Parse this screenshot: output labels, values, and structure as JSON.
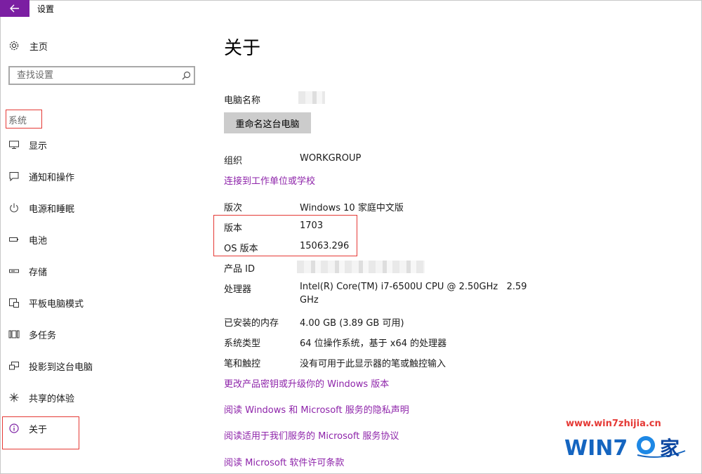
{
  "window": {
    "title": "设置"
  },
  "sidebar": {
    "home_label": "主页",
    "search_placeholder": "查找设置",
    "section_label": "系统",
    "items": [
      {
        "label": "显示",
        "icon": "monitor-icon"
      },
      {
        "label": "通知和操作",
        "icon": "notification-icon"
      },
      {
        "label": "电源和睡眠",
        "icon": "power-icon"
      },
      {
        "label": "电池",
        "icon": "battery-icon"
      },
      {
        "label": "存储",
        "icon": "storage-icon"
      },
      {
        "label": "平板电脑模式",
        "icon": "tablet-mode-icon"
      },
      {
        "label": "多任务",
        "icon": "multitask-icon"
      },
      {
        "label": "投影到这台电脑",
        "icon": "projection-icon"
      },
      {
        "label": "共享的体验",
        "icon": "shared-experience-icon"
      },
      {
        "label": "关于",
        "icon": "info-icon",
        "selected": true
      }
    ]
  },
  "main": {
    "title": "关于",
    "pc_name_label": "电脑名称",
    "rename_button": "重命名这台电脑",
    "org_label": "组织",
    "org_value": "WORKGROUP",
    "connect_link": "连接到工作单位或学校",
    "edition_label": "版次",
    "edition_value": "Windows 10 家庭中文版",
    "version_label": "版本",
    "version_value": "1703",
    "os_build_label": "OS 版本",
    "os_build_value": "15063.296",
    "product_id_label": "产品 ID",
    "processor_label": "处理器",
    "processor_value_line1": "Intel(R) Core(TM) i7-6500U CPU @ 2.50GHz   2.59",
    "processor_value_line2": "GHz",
    "ram_label": "已安装的内存",
    "ram_value": "4.00 GB (3.89 GB 可用)",
    "system_type_label": "系统类型",
    "system_type_value": "64 位操作系统，基于 x64 的处理器",
    "pen_touch_label": "笔和触控",
    "pen_touch_value": "没有可用于此显示器的笔或触控输入",
    "links": [
      "更改产品密钥或升级你的 Windows 版本",
      "阅读 Windows 和 Microsoft 服务的隐私声明",
      "阅读适用于我们服务的 Microsoft 服务协议",
      "阅读 Microsoft 软件许可条款"
    ]
  },
  "watermark": {
    "url": "www.win7zhijia.cn",
    "logo_text": "WIN7",
    "logo_suffix": "家"
  },
  "colors": {
    "accent": "#7b1fa2",
    "link": "#8e24aa",
    "highlight": "#e53935"
  }
}
